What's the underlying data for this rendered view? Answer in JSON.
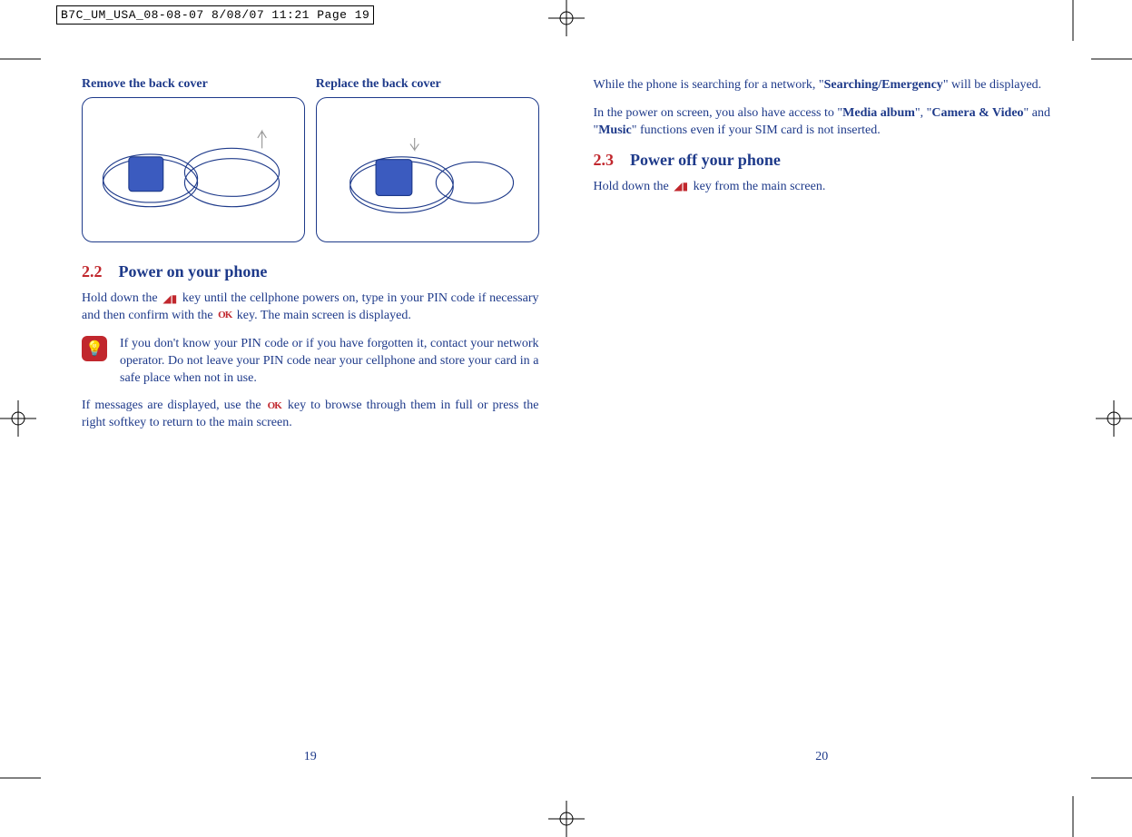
{
  "print_header": "B7C_UM_USA_08-08-07  8/08/07  11:21  Page 19",
  "left": {
    "fig1_title": "Remove the back cover",
    "fig2_title": "Replace the back cover",
    "section_num": "2.2",
    "section_title": "Power on your phone",
    "para1a": "Hold down the ",
    "para1b": " key until the cellphone powers on, type in your PIN code if necessary and then confirm with the ",
    "para1c": " key. The main screen is displayed.",
    "tip": "If you don't know your PIN code or if you have forgotten it, contact your network operator. Do not leave your PIN code near your cellphone and store your card in a safe place when not in use.",
    "para2a": "If messages are displayed, use the ",
    "para2b": " key to browse through them in full or press the right softkey to return to the main screen.",
    "page_num": "19"
  },
  "right": {
    "para1a": "While the phone is searching for a network, \"",
    "para1b_bold": "Searching/Emergency",
    "para1c": "\" will be displayed.",
    "para2a": "In the power on screen, you also have access to \"",
    "para2b_bold": "Media album",
    "para2c": "\", \"",
    "para2d_bold": "Camera & Video",
    "para2e": "\" and \"",
    "para2f_bold": "Music",
    "para2g": "\" functions even if your SIM card is not inserted.",
    "section_num": "2.3",
    "section_title": "Power off your phone",
    "para3a": "Hold down the ",
    "para3b": " key from the main screen.",
    "page_num": "20"
  },
  "icons": {
    "power_key": "⎯",
    "ok_key": "OK",
    "tip": "✧"
  }
}
